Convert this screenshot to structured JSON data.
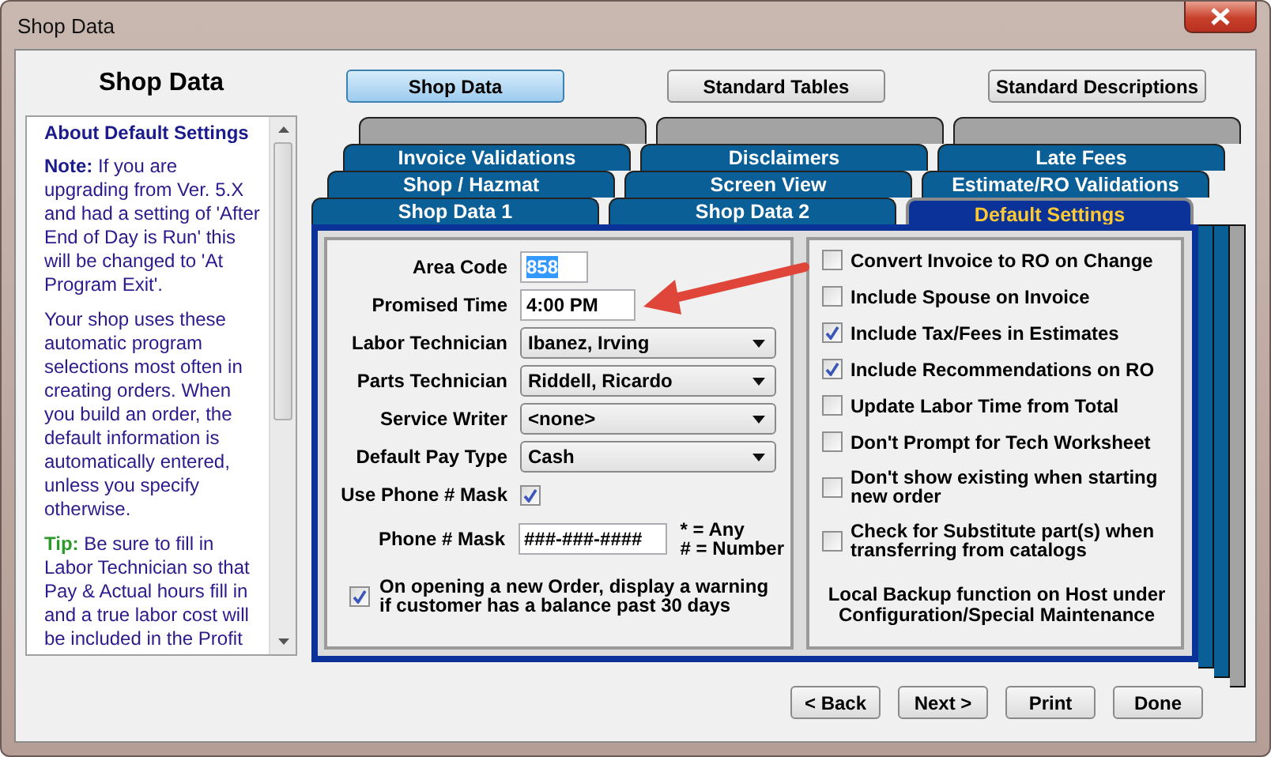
{
  "window": {
    "title": "Shop Data"
  },
  "left_panel": {
    "heading": "Shop Data",
    "help": {
      "title": "About Default Settings",
      "paragraphs": [
        {
          "kind": "note",
          "lead": "Note:",
          "text": "If you are upgrading from Ver. 5.X and had a setting of 'After End of Day is Run' this will be changed to 'At Program Exit'."
        },
        {
          "kind": "plain",
          "text": "Your shop uses these automatic program selections most often in creating orders. When you build an order, the default information is automatically entered, unless you specify otherwise."
        },
        {
          "kind": "tip",
          "lead": "Tip:",
          "text": "Be sure to fill in Labor Technician so that Pay & Actual hours fill in and a true labor cost will be included in the Profit"
        }
      ]
    }
  },
  "top_buttons": [
    {
      "label": "Shop Data",
      "selected": true
    },
    {
      "label": "Standard Tables",
      "selected": false
    },
    {
      "label": "Standard Descriptions",
      "selected": false
    }
  ],
  "tab_rows": [
    [
      {
        "label": "Invoice Validations",
        "selected": false
      },
      {
        "label": "Disclaimers",
        "selected": false
      },
      {
        "label": "Late Fees",
        "selected": false
      }
    ],
    [
      {
        "label": "Shop / Hazmat",
        "selected": false
      },
      {
        "label": "Screen View",
        "selected": false
      },
      {
        "label": "Estimate/RO Validations",
        "selected": false
      }
    ],
    [
      {
        "label": "Shop Data 1",
        "selected": false
      },
      {
        "label": "Shop Data 2",
        "selected": false
      },
      {
        "label": "Default Settings",
        "selected": true
      }
    ]
  ],
  "form_fields": [
    {
      "kind": "text",
      "label": "Area Code",
      "value": "858",
      "text_selected": true
    },
    {
      "kind": "text",
      "label": "Promised Time",
      "value": "4:00 PM",
      "text_selected": false
    },
    {
      "kind": "dropdown",
      "label": "Labor Technician",
      "value": "Ibanez, Irving"
    },
    {
      "kind": "dropdown",
      "label": "Parts Technician",
      "value": "Riddell, Ricardo"
    },
    {
      "kind": "dropdown",
      "label": "Service Writer",
      "value": "<none>"
    },
    {
      "kind": "dropdown",
      "label": "Default Pay Type",
      "value": "Cash"
    },
    {
      "kind": "checkbox",
      "label": "Use Phone # Mask",
      "checked": true
    },
    {
      "kind": "mask",
      "label": "Phone # Mask",
      "value": "###-###-####",
      "hints": [
        "* = Any",
        "# = Number"
      ]
    }
  ],
  "warning_checkbox": {
    "label": "On opening a new Order, display a warning if customer has a balance past 30 days",
    "checked": true
  },
  "options": [
    {
      "label": "Convert Invoice to RO on Change",
      "checked": false
    },
    {
      "label": "Include Spouse on Invoice",
      "checked": false
    },
    {
      "label": "Include Tax/Fees in Estimates",
      "checked": true
    },
    {
      "label": "Include Recommendations on RO",
      "checked": true
    },
    {
      "label": "Update Labor Time from Total",
      "checked": false
    },
    {
      "label": "Don't Prompt for Tech Worksheet",
      "checked": false
    },
    {
      "label": "Don't show existing when starting new order",
      "checked": false
    },
    {
      "label": "Check for Substitute part(s) when transferring from catalogs",
      "checked": false
    }
  ],
  "backup_note": "Local Backup function on Host under Configuration/Special Maintenance",
  "bottom_buttons": [
    "< Back",
    "Next >",
    "Print",
    "Done"
  ]
}
